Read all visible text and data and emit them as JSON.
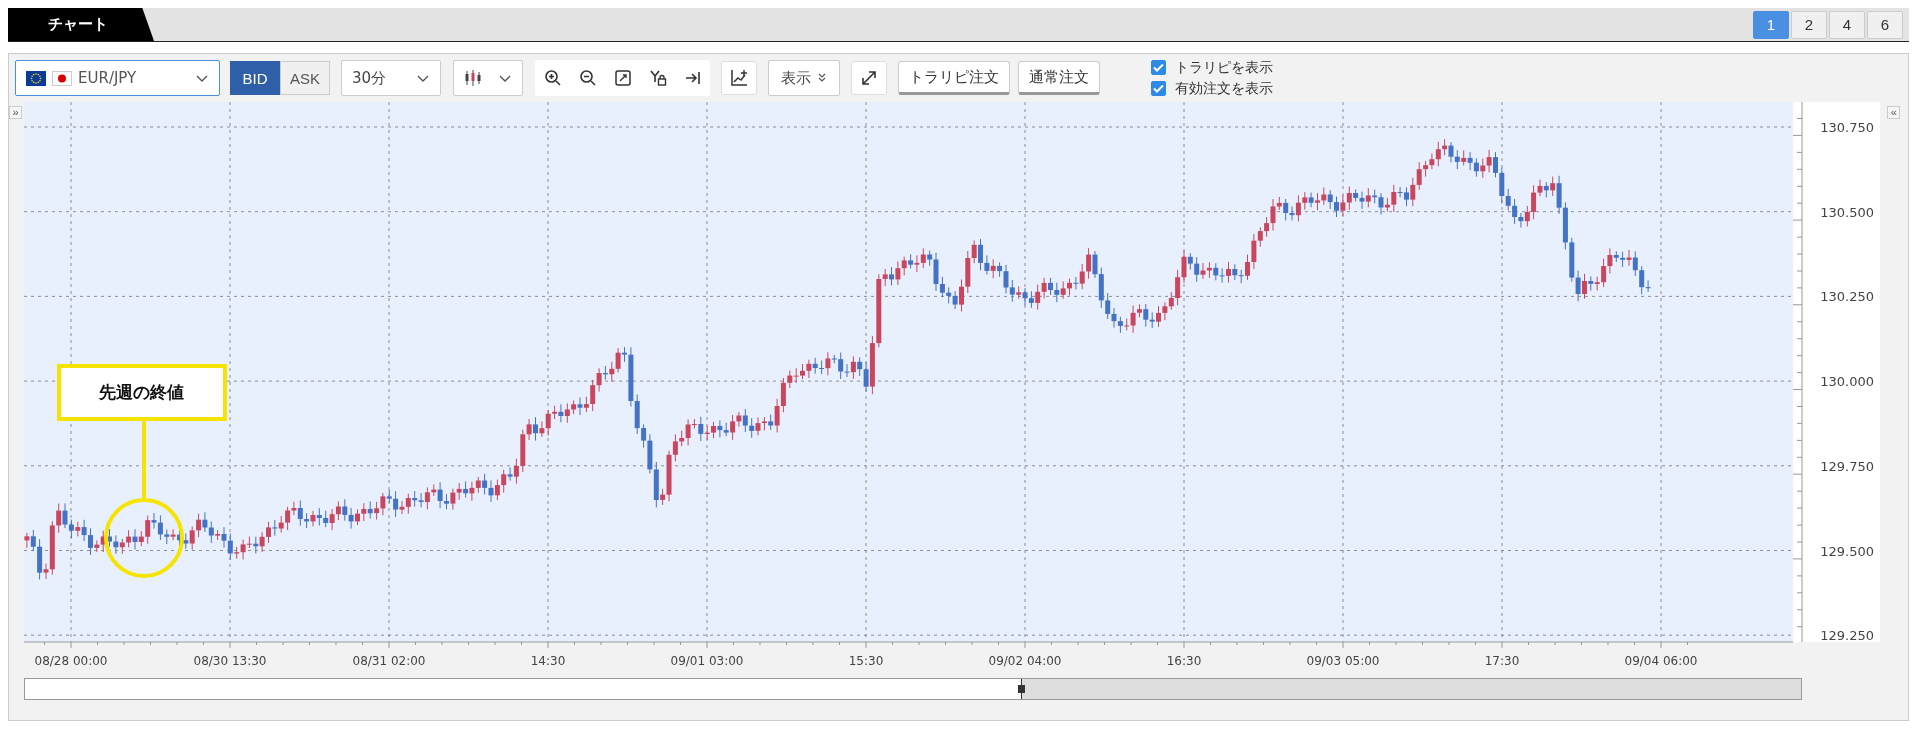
{
  "tab": {
    "label": "チャート",
    "selected": true
  },
  "layouts": [
    {
      "label": "1",
      "selected": true
    },
    {
      "label": "2",
      "selected": false
    },
    {
      "label": "4",
      "selected": false
    },
    {
      "label": "6",
      "selected": false
    }
  ],
  "toolbar": {
    "pair": {
      "value": "EUR/JPY"
    },
    "price_side": [
      {
        "label": "BID",
        "selected": true
      },
      {
        "label": "ASK",
        "selected": false
      }
    ],
    "interval": {
      "value": "30分"
    },
    "display_button": "表示",
    "order_buttons": [
      "トラリピ注文",
      "通常注文"
    ],
    "options": [
      {
        "label": "トラリピを表示",
        "checked": true
      },
      {
        "label": "有効注文を表示",
        "checked": true
      }
    ]
  },
  "chart": {
    "left_toggle": "»",
    "right_toggle": "«",
    "price_labels": [
      "130.750",
      "130.500",
      "130.250",
      "130.000",
      "129.750",
      "129.500",
      "129.250"
    ],
    "time_labels": [
      "08/28 00:00",
      "08/30 13:30",
      "08/31 02:00",
      "14:30",
      "09/01 03:00",
      "15:30",
      "09/02 04:00",
      "16:30",
      "09/03 05:00",
      "17:30",
      "09/04 06:00"
    ],
    "annotation": {
      "text": "先週の終値"
    }
  }
}
